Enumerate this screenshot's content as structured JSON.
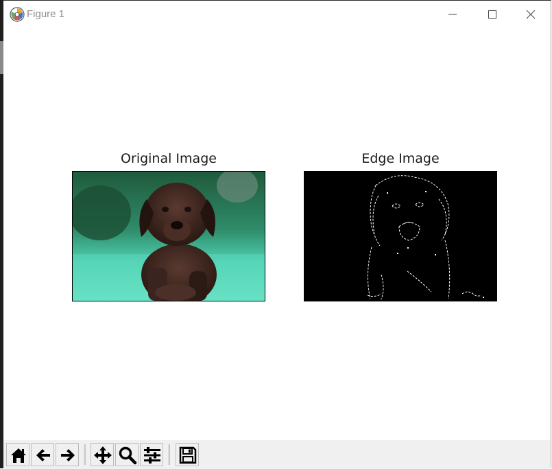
{
  "window": {
    "title": "Figure 1"
  },
  "subplots": [
    {
      "title": "Original Image",
      "image": "puppy-color-photo"
    },
    {
      "title": "Edge Image",
      "image": "puppy-edge-map"
    }
  ],
  "toolbar": {
    "tools": [
      {
        "name": "home",
        "icon": "home-icon"
      },
      {
        "name": "back",
        "icon": "arrow-left-icon"
      },
      {
        "name": "forward",
        "icon": "arrow-right-icon"
      },
      {
        "name": "pan",
        "icon": "move-icon"
      },
      {
        "name": "zoom",
        "icon": "zoom-icon"
      },
      {
        "name": "configure-subplots",
        "icon": "sliders-icon"
      },
      {
        "name": "save",
        "icon": "save-icon"
      }
    ]
  },
  "colors": {
    "titlebar_text": "#8c8c8c",
    "toolbar_bg": "#f0f0f0",
    "edge_bg": "#000000"
  }
}
